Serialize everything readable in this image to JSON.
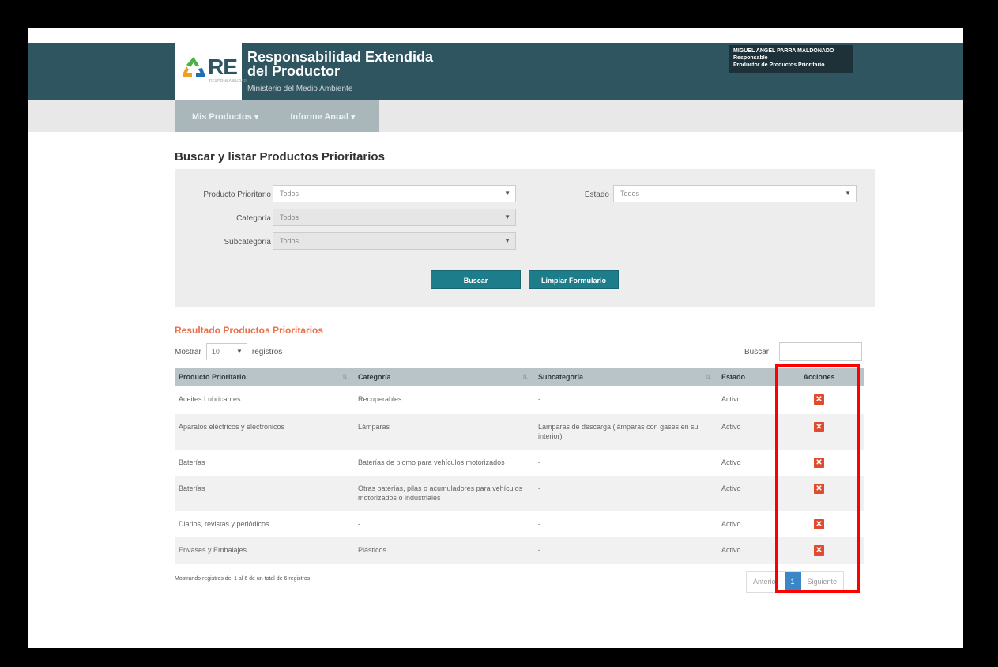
{
  "header": {
    "logo_text": "RE",
    "logo_sub": "RESPONSABILIDAD",
    "title": "Responsabilidad Extendida del Productor",
    "subtitle": "Ministerio del Medio Ambiente",
    "user": {
      "name": "MIGUEL ANGEL PARRA MALDONADO",
      "role": "Responsable",
      "org": "Productor de Productos Prioritario"
    }
  },
  "nav": {
    "items": [
      "Mis Productos ▾",
      "Informe Anual ▾"
    ]
  },
  "page_title": "Buscar y listar Productos Prioritarios",
  "filters": {
    "producto_label": "Producto Prioritario",
    "producto_value": "Todos",
    "categoria_label": "Categoría",
    "categoria_value": "Todos",
    "subcategoria_label": "Subcategoría",
    "subcategoria_value": "Todos",
    "estado_label": "Estado",
    "estado_value": "Todos",
    "buscar_button": "Buscar",
    "limpiar_button": "Limpiar Formulario"
  },
  "results": {
    "title": "Resultado Productos Prioritarios",
    "show_prefix": "Mostrar",
    "show_value": "10",
    "show_suffix": "registros",
    "search_label": "Buscar:",
    "columns": [
      "Producto Prioritario",
      "Categoría",
      "Subcategoría",
      "Estado",
      "Acciones"
    ],
    "rows": [
      {
        "producto": "Aceites Lubricantes",
        "categoria": "Recuperables",
        "subcategoria": "-",
        "estado": "Activo"
      },
      {
        "producto": "Aparatos eléctricos y electrónicos",
        "categoria": "Lámparas",
        "subcategoria": "Lámparas de descarga (lámparas con gases en su interior)",
        "estado": "Activo"
      },
      {
        "producto": "Baterías",
        "categoria": "Baterías de plomo para vehículos motorizados",
        "subcategoria": "-",
        "estado": "Activo"
      },
      {
        "producto": "Baterías",
        "categoria": "Otras baterías, pilas o acumuladores para vehículos motorizados o industriales",
        "subcategoria": "-",
        "estado": "Activo"
      },
      {
        "producto": "Diarios, revistas y periódicos",
        "categoria": "-",
        "subcategoria": "-",
        "estado": "Activo"
      },
      {
        "producto": "Envases y Embalajes",
        "categoria": "Plásticos",
        "subcategoria": "-",
        "estado": "Activo"
      }
    ],
    "info": "Mostrando registros del 1 al 6 de un total de 6 registros",
    "pager": {
      "prev": "Anterior",
      "current": "1",
      "next": "Siguiente"
    }
  },
  "colors": {
    "header_bg": "#2f5560",
    "button_bg": "#1e7d8a",
    "results_title": "#e8704a",
    "delete_icon": "#e04a2f",
    "highlight": "#ff0000"
  }
}
